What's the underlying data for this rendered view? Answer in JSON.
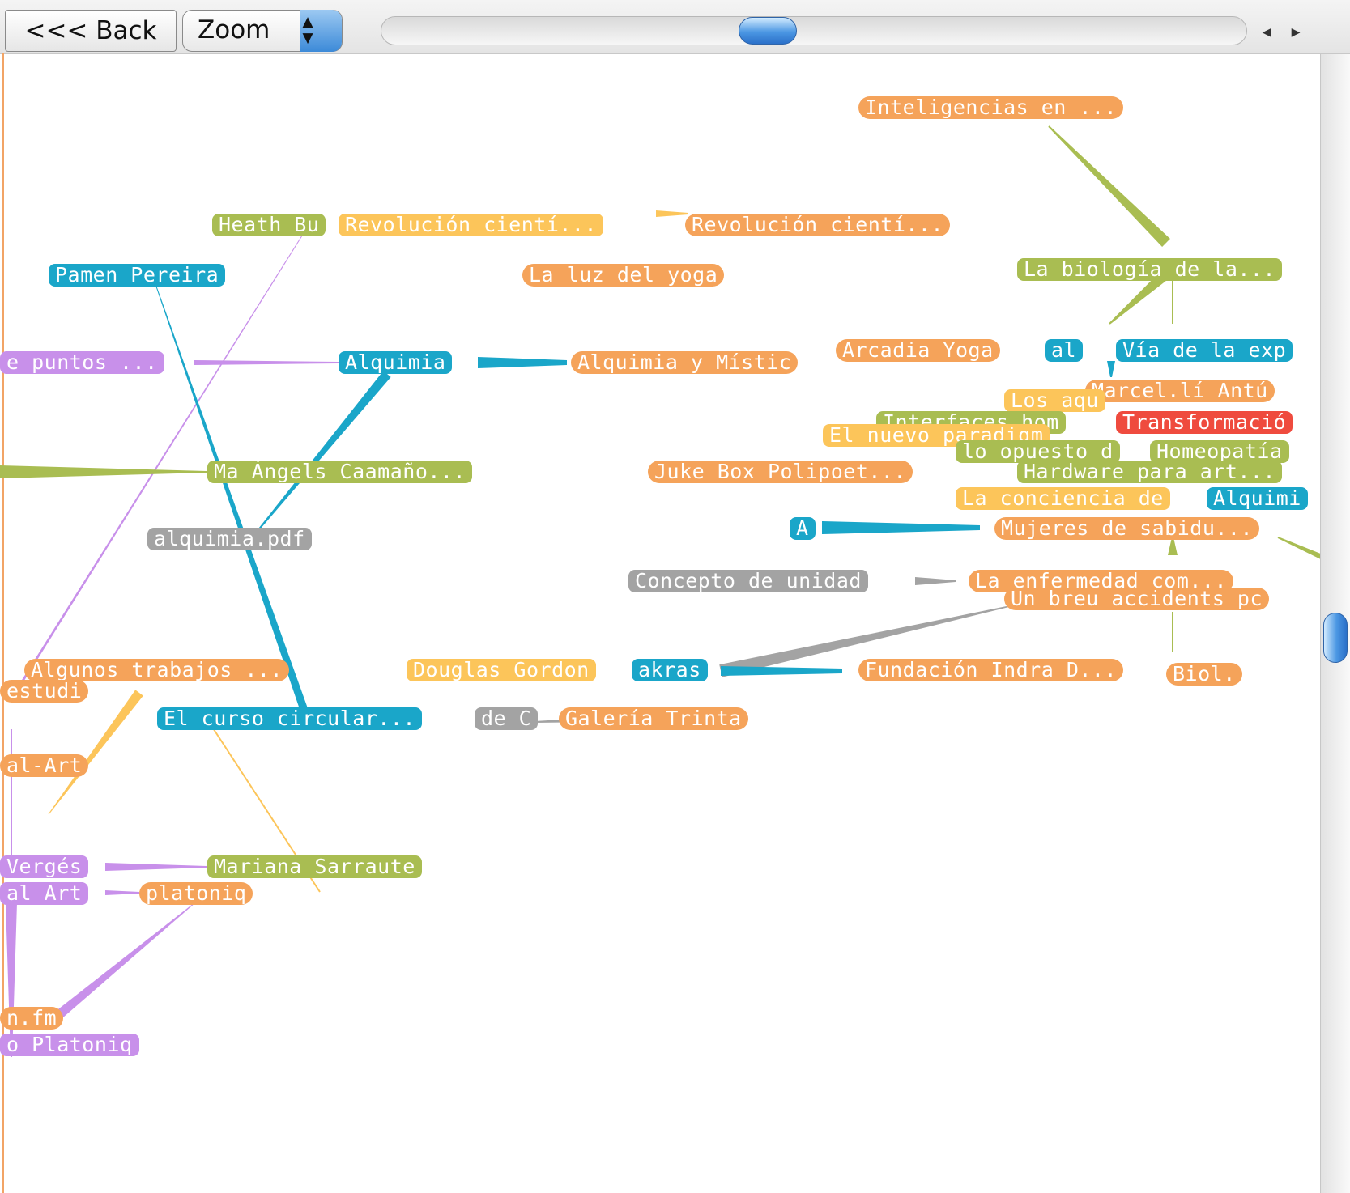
{
  "toolbar": {
    "back_label": "<<< Back",
    "zoom_label": "Zoom",
    "stepper_glyph": "▲▼",
    "scroll_left_glyph": "◀",
    "scroll_right_glyph": "▶"
  },
  "colors": {
    "orange": "#f5a35a",
    "green": "#a9bd52",
    "blue": "#1aa6c9",
    "purple": "#c890ea",
    "yellow": "#fcc55a",
    "gray": "#a3a3a3",
    "red": "#ef4b3e"
  },
  "nodes": [
    {
      "id": "n_inteligencias",
      "label": "Inteligencias en ...",
      "color": "orange"
    },
    {
      "id": "n_heath",
      "label": "Heath Bu",
      "color": "green"
    },
    {
      "id": "n_rev1",
      "label": "Revolución cientí...",
      "color": "yellow"
    },
    {
      "id": "n_rev2",
      "label": "Revolución cientí...",
      "color": "orange"
    },
    {
      "id": "n_pamen",
      "label": "Pamen Pereira",
      "color": "blue"
    },
    {
      "id": "n_luz",
      "label": "La luz del yoga",
      "color": "orange"
    },
    {
      "id": "n_biologia",
      "label": "La biología de la...",
      "color": "green"
    },
    {
      "id": "n_puntos",
      "label": "e puntos ...",
      "color": "purple"
    },
    {
      "id": "n_alquimia",
      "label": "Alquimia",
      "color": "blue"
    },
    {
      "id": "n_alquimia_mistica",
      "label": "Alquimia y Místic",
      "color": "orange"
    },
    {
      "id": "n_arcadia",
      "label": "Arcadia Yoga",
      "color": "orange"
    },
    {
      "id": "n_al",
      "label": "al",
      "color": "blue"
    },
    {
      "id": "n_via",
      "label": "Vía de la exp",
      "color": "blue"
    },
    {
      "id": "n_marcel",
      "label": "Marcel.lí Antú",
      "color": "orange"
    },
    {
      "id": "n_los",
      "label": "Los aqu",
      "color": "yellow"
    },
    {
      "id": "n_interfaces",
      "label": "Interfaces hom",
      "color": "green"
    },
    {
      "id": "n_transformacion",
      "label": "Transformació",
      "color": "red"
    },
    {
      "id": "n_nuevo",
      "label": "El nuevo paradigm",
      "color": "yellow"
    },
    {
      "id": "n_opuesto",
      "label": "lo opuesto d",
      "color": "green"
    },
    {
      "id": "n_homeopatia",
      "label": "Homeopatía",
      "color": "green"
    },
    {
      "id": "n_ma",
      "label": "Ma Àngels Caamaño...",
      "color": "green"
    },
    {
      "id": "n_juke",
      "label": "Juke Box Polipoet...",
      "color": "orange"
    },
    {
      "id": "n_hardware",
      "label": "Hardware para art...",
      "color": "green"
    },
    {
      "id": "n_conciencia",
      "label": "La conciencia de",
      "color": "yellow"
    },
    {
      "id": "n_alquimi2",
      "label": "Alquimi",
      "color": "blue"
    },
    {
      "id": "n_alquimia_pdf",
      "label": "alquimia.pdf",
      "color": "gray"
    },
    {
      "id": "n_a",
      "label": "A",
      "color": "blue"
    },
    {
      "id": "n_mujeres",
      "label": "Mujeres de sabidu...",
      "color": "orange"
    },
    {
      "id": "n_concepto",
      "label": "Concepto de unidad",
      "color": "gray"
    },
    {
      "id": "n_enfermedad",
      "label": "La enfermedad com...",
      "color": "orange"
    },
    {
      "id": "n_accidents",
      "label": "Un breu accidents pc",
      "color": "orange"
    },
    {
      "id": "n_algunos",
      "label": "Algunos trabajos ...",
      "color": "orange"
    },
    {
      "id": "n_douglas",
      "label": "Douglas Gordon",
      "color": "yellow"
    },
    {
      "id": "n_akras",
      "label": "akras",
      "color": "blue"
    },
    {
      "id": "n_fundacion",
      "label": "Fundación Indra D...",
      "color": "orange"
    },
    {
      "id": "n_biol",
      "label": "Biol.",
      "color": "orange"
    },
    {
      "id": "n_estudi",
      "label": "estudi",
      "color": "orange"
    },
    {
      "id": "n_curso",
      "label": "El curso circular...",
      "color": "blue"
    },
    {
      "id": "n_de",
      "label": "de C",
      "color": "gray"
    },
    {
      "id": "n_galeria",
      "label": "Galería Trinta",
      "color": "orange"
    },
    {
      "id": "n_alart",
      "label": "al-Art",
      "color": "orange"
    },
    {
      "id": "n_verges",
      "label": "Vergés",
      "color": "purple"
    },
    {
      "id": "n_mariana",
      "label": "Mariana Sarraute",
      "color": "green"
    },
    {
      "id": "n_alart2",
      "label": "al Art",
      "color": "purple"
    },
    {
      "id": "n_platoniq",
      "label": "platoniq",
      "color": "orange"
    },
    {
      "id": "n_nfm",
      "label": "n.fm",
      "color": "orange"
    },
    {
      "id": "n_platoniq2",
      "label": "o Platoniq",
      "color": "purple"
    }
  ]
}
